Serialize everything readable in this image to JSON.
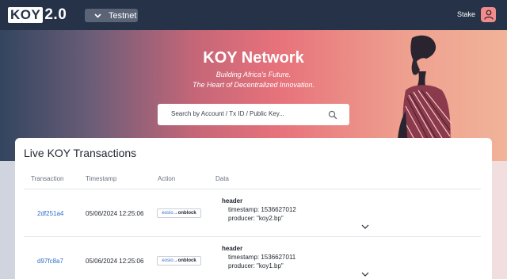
{
  "header": {
    "logo_main": "KOY",
    "logo_version": "2.0",
    "network_label": "Testnet",
    "stake_label": "Stake",
    "icons": {
      "network": "chevron-down-icon",
      "user": "user-icon"
    }
  },
  "hero": {
    "title": "KOY Network",
    "subtitle_line1": "Building Africa's Future.",
    "subtitle_line2": "The Heart of Decentralized Innovation.",
    "search_placeholder": "Search by Account / Tx ID / Public Key...",
    "search_icon": "search-icon"
  },
  "transactions": {
    "title": "Live KOY Transactions",
    "columns": [
      "Transaction",
      "Timestamp",
      "Action",
      "Data"
    ],
    "rows": [
      {
        "id": "2df251a4",
        "timestamp": "05/06/2024 12:25:06",
        "action_contract": "eosio",
        "action_arrow": "→",
        "action_name": "onblock",
        "data_header": "header",
        "data_timestamp_label": "timestamp:",
        "data_timestamp": "1536627012",
        "data_producer_label": "producer:",
        "data_producer": "\"koy2.bp\""
      },
      {
        "id": "d97fc8a7",
        "timestamp": "05/06/2024 12:25:06",
        "action_contract": "eosio",
        "action_arrow": "→",
        "action_name": "onblock",
        "data_header": "header",
        "data_timestamp_label": "timestamp:",
        "data_timestamp": "1536627011",
        "data_producer_label": "producer:",
        "data_producer": "\"koy1.bp\""
      }
    ]
  },
  "colors": {
    "navbar": "#253247",
    "accent_link": "#2f6fc8",
    "user_button": "#ef8c8c"
  }
}
